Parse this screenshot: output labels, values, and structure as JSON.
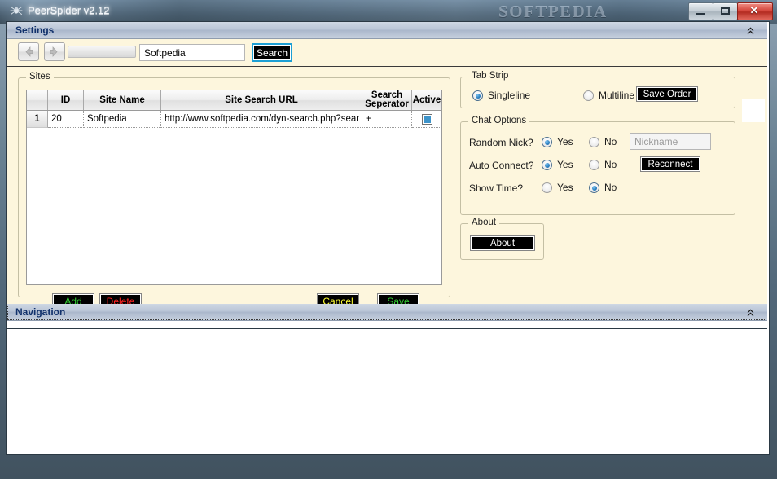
{
  "window": {
    "title": "PeerSpider v2.12",
    "icon": "spider-icon",
    "watermark": "SOFTPEDIA",
    "controls": {
      "minimize": "minimize-button",
      "maximize": "maximize-button",
      "close_glyph": "✕"
    }
  },
  "settings_panel": {
    "header": "Settings",
    "collapse_icon": "chevron-double-up-icon"
  },
  "sites_group": {
    "title": "Sites",
    "grid": {
      "columns": [
        "",
        "ID",
        "Site Name",
        "Site Search URL",
        "Search Seperator",
        "Active"
      ],
      "rows": [
        {
          "row_number": "1",
          "id": "20",
          "site_name": "Softpedia",
          "site_search_url": "http://www.softpedia.com/dyn-search.php?sear",
          "search_seperator": "+",
          "active": true
        }
      ]
    },
    "buttons": {
      "add": {
        "label": "Add",
        "color": "#33cc33"
      },
      "delete": {
        "label": "Delete",
        "color": "#ff2222"
      },
      "cancel": {
        "label": "Cancel",
        "color": "#ffff33"
      },
      "save": {
        "label": "Save",
        "color": "#33cc33"
      }
    }
  },
  "tab_strip_group": {
    "title": "Tab Strip",
    "options": [
      {
        "label": "Singleline",
        "selected": true
      },
      {
        "label": "Multiline",
        "selected": false
      }
    ],
    "save_order_button": {
      "label": "Save Order",
      "color": "#ffffff"
    }
  },
  "chat_options_group": {
    "title": "Chat Options",
    "rows": [
      {
        "label": "Random Nick?",
        "yes": "Yes",
        "no": "No",
        "value": "yes"
      },
      {
        "label": "Auto Connect?",
        "yes": "Yes",
        "no": "No",
        "value": "yes"
      },
      {
        "label": "Show Time?",
        "yes": "Yes",
        "no": "No",
        "value": "no"
      }
    ],
    "nickname_field": {
      "placeholder": "Nickname",
      "value": "",
      "disabled": true
    },
    "reconnect_button": {
      "label": "Reconnect",
      "color": "#ffffff"
    }
  },
  "about_group": {
    "title": "About",
    "button": {
      "label": "About",
      "color": "#ffffff"
    }
  },
  "navigation_panel": {
    "header": "Navigation",
    "collapse_icon": "chevron-double-up-icon",
    "back_button": "back-arrow-icon",
    "forward_button": "forward-arrow-icon",
    "address_combo": "",
    "search_input": {
      "value": "Softpedia",
      "placeholder": ""
    },
    "search_button": {
      "label": "Search",
      "color": "#ffffff"
    }
  },
  "colors": {
    "panel_background": "#fdf6dd",
    "header_text": "#11316b",
    "button_background": "#000000",
    "accent_focus": "#1c9fd4"
  }
}
